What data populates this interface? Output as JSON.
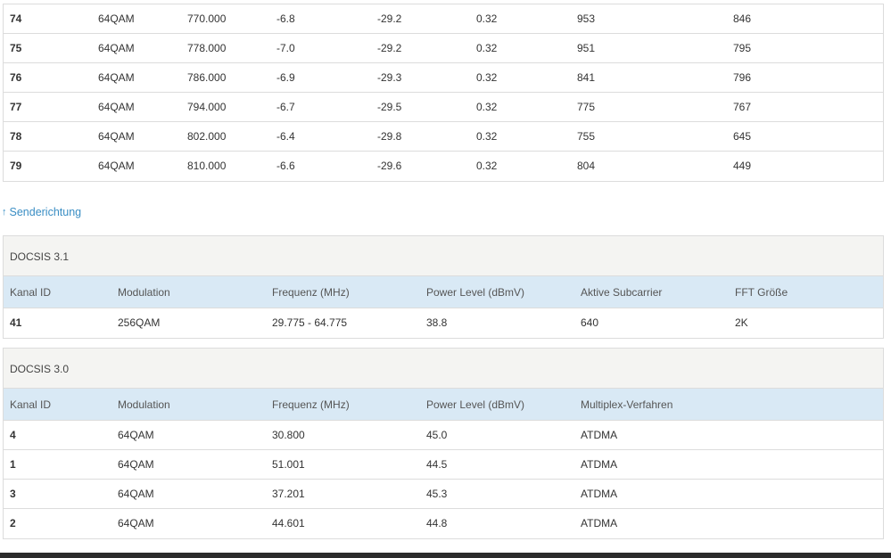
{
  "downstream_rows": [
    [
      "74",
      "64QAM",
      "770.000",
      "-6.8",
      "-29.2",
      "0.32",
      "953",
      "846"
    ],
    [
      "75",
      "64QAM",
      "778.000",
      "-7.0",
      "-29.2",
      "0.32",
      "951",
      "795"
    ],
    [
      "76",
      "64QAM",
      "786.000",
      "-6.9",
      "-29.3",
      "0.32",
      "841",
      "796"
    ],
    [
      "77",
      "64QAM",
      "794.000",
      "-6.7",
      "-29.5",
      "0.32",
      "775",
      "767"
    ],
    [
      "78",
      "64QAM",
      "802.000",
      "-6.4",
      "-29.8",
      "0.32",
      "755",
      "645"
    ],
    [
      "79",
      "64QAM",
      "810.000",
      "-6.6",
      "-29.6",
      "0.32",
      "804",
      "449"
    ]
  ],
  "upstream_link": {
    "arrow": "↑",
    "label": "Senderichtung"
  },
  "docsis31": {
    "title": "DOCSIS 3.1",
    "headers": [
      "Kanal ID",
      "Modulation",
      "Frequenz (MHz)",
      "Power Level (dBmV)",
      "Aktive Subcarrier",
      "FFT Größe"
    ],
    "rows": [
      [
        "41",
        "256QAM",
        "29.775 - 64.775",
        "38.8",
        "640",
        "2K"
      ]
    ]
  },
  "docsis30": {
    "title": "DOCSIS 3.0",
    "headers": [
      "Kanal ID",
      "Modulation",
      "Frequenz (MHz)",
      "Power Level (dBmV)",
      "Multiplex-Verfahren"
    ],
    "rows": [
      [
        "4",
        "64QAM",
        "30.800",
        "45.0",
        "ATDMA"
      ],
      [
        "1",
        "64QAM",
        "51.001",
        "44.5",
        "ATDMA"
      ],
      [
        "3",
        "64QAM",
        "37.201",
        "45.3",
        "ATDMA"
      ],
      [
        "2",
        "64QAM",
        "44.601",
        "44.8",
        "ATDMA"
      ]
    ]
  }
}
